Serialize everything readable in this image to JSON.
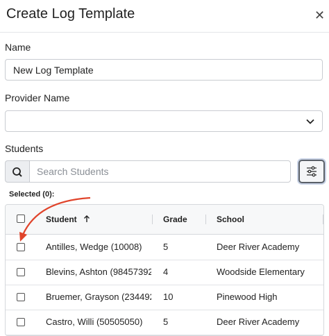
{
  "dialog": {
    "title": "Create Log Template",
    "close_icon": "close-icon"
  },
  "name_field": {
    "label": "Name",
    "value": "New Log Template"
  },
  "provider_field": {
    "label": "Provider Name",
    "value": "",
    "icon": "chevron-down-icon"
  },
  "students": {
    "label": "Students",
    "search_placeholder": "Search Students",
    "search_icon": "search-icon",
    "filter_icon": "sliders-icon",
    "selected_text": "Selected (0):",
    "columns": {
      "student": "Student",
      "student_sort_icon": "arrow-up-icon",
      "grade": "Grade",
      "school": "School"
    },
    "rows": [
      {
        "student": "Antilles, Wedge (10008)",
        "grade": "5",
        "school": "Deer River Academy"
      },
      {
        "student": "Blevins, Ashton (98457392",
        "grade": "4",
        "school": "Woodside Elementary"
      },
      {
        "student": "Bruemer, Grayson (2344929",
        "grade": "10",
        "school": "Pinewood High"
      },
      {
        "student": "Castro, Willi (50505050)",
        "grade": "5",
        "school": "Deer River Academy"
      }
    ]
  },
  "annotation": {
    "color": "#e0442b",
    "icon": "arrow-annotation"
  }
}
